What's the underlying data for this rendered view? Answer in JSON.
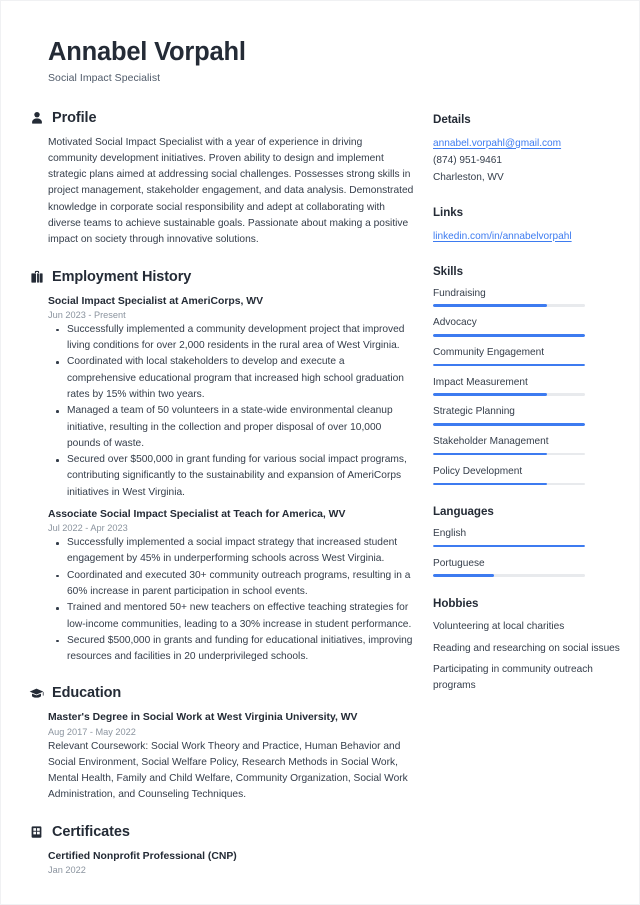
{
  "header": {
    "name": "Annabel Vorpahl",
    "job_title": "Social Impact Specialist"
  },
  "accent_color": "#3d7bf0",
  "sections": {
    "profile": {
      "title": "Profile",
      "icon": "person-icon",
      "text": "Motivated Social Impact Specialist with a year of experience in driving community development initiatives. Proven ability to design and implement strategic plans aimed at addressing social challenges. Possesses strong skills in project management, stakeholder engagement, and data analysis. Demonstrated knowledge in corporate social responsibility and adept at collaborating with diverse teams to achieve sustainable goals. Passionate about making a positive impact on society through innovative solutions."
    },
    "employment": {
      "title": "Employment History",
      "icon": "briefcase-icon",
      "jobs": [
        {
          "title": "Social Impact Specialist at AmeriCorps, WV",
          "date": "Jun 2023 - Present",
          "bullets": [
            "Successfully implemented a community development project that improved living conditions for over 2,000 residents in the rural area of West Virginia.",
            "Coordinated with local stakeholders to develop and execute a comprehensive educational program that increased high school graduation rates by 15% within two years.",
            "Managed a team of 50 volunteers in a state-wide environmental cleanup initiative, resulting in the collection and proper disposal of over 10,000 pounds of waste.",
            "Secured over $500,000 in grant funding for various social impact programs, contributing significantly to the sustainability and expansion of AmeriCorps initiatives in West Virginia."
          ]
        },
        {
          "title": "Associate Social Impact Specialist at Teach for America, WV",
          "date": "Jul 2022 - Apr 2023",
          "bullets": [
            "Successfully implemented a social impact strategy that increased student engagement by 45% in underperforming schools across West Virginia.",
            "Coordinated and executed 30+ community outreach programs, resulting in a 60% increase in parent participation in school events.",
            "Trained and mentored 50+ new teachers on effective teaching strategies for low-income communities, leading to a 30% increase in student performance.",
            "Secured $500,000 in grants and funding for educational initiatives, improving resources and facilities in 20 underprivileged schools."
          ]
        }
      ]
    },
    "education": {
      "title": "Education",
      "icon": "graduation-cap-icon",
      "entries": [
        {
          "title": "Master's Degree in Social Work at West Virginia University, WV",
          "date": "Aug 2017 - May 2022",
          "description": "Relevant Coursework: Social Work Theory and Practice, Human Behavior and Social Environment, Social Welfare Policy, Research Methods in Social Work, Mental Health, Family and Child Welfare, Community Organization, Social Work Administration, and Counseling Techniques."
        }
      ]
    },
    "certificates": {
      "title": "Certificates",
      "icon": "clipboard-icon",
      "entries": [
        {
          "title": "Certified Nonprofit Professional (CNP)",
          "date": "Jan 2022"
        }
      ]
    }
  },
  "sidebar": {
    "details": {
      "title": "Details",
      "email": "annabel.vorpahl@gmail.com",
      "phone": "(874) 951-9461",
      "location": "Charleston, WV"
    },
    "links": {
      "title": "Links",
      "items": [
        {
          "label": "linkedin.com/in/annabelvorpahl"
        }
      ]
    },
    "skills": {
      "title": "Skills",
      "items": [
        {
          "label": "Fundraising",
          "level": 75
        },
        {
          "label": "Advocacy",
          "level": 100
        },
        {
          "label": "Community Engagement",
          "level": 100
        },
        {
          "label": "Impact Measurement",
          "level": 75
        },
        {
          "label": "Strategic Planning",
          "level": 100
        },
        {
          "label": "Stakeholder Management",
          "level": 75
        },
        {
          "label": "Policy Development",
          "level": 75
        }
      ]
    },
    "languages": {
      "title": "Languages",
      "items": [
        {
          "label": "English",
          "level": 100
        },
        {
          "label": "Portuguese",
          "level": 40
        }
      ]
    },
    "hobbies": {
      "title": "Hobbies",
      "items": [
        "Volunteering at local charities",
        "Reading and researching on social issues",
        "Participating in community outreach programs"
      ]
    }
  }
}
